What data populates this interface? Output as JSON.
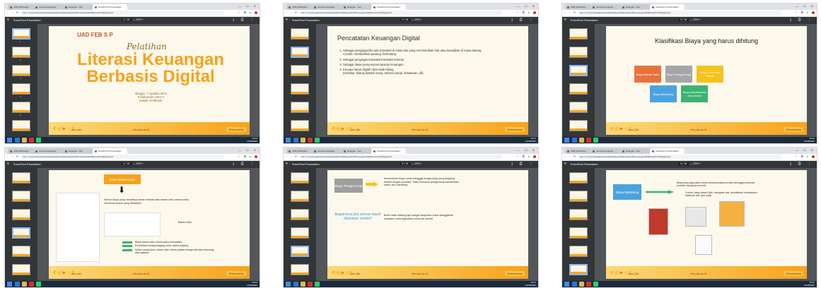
{
  "browser": {
    "tabs": [
      "(789) WhatsApp",
      "Literasi Keuangan...",
      "Ruangan - Kisi",
      "PowerPoint Presentation"
    ],
    "url": "File | C:/Users/Asus/Downloads/Pelatihan%20Literasi%20Keuangan%20Berbasis%20Digital.pdf",
    "window_controls": "— ☐ ✕"
  },
  "pdf_toolbar": {
    "title": "PowerPoint Presentation",
    "pages": [
      "1 / 16",
      "2 / 16",
      "3 / 16",
      "4 / 16",
      "5 / 16",
      "6 / 16"
    ],
    "zoom": "— 97% +",
    "right_icons": "⤓ ⎙ ⋮",
    "menu_icon": "≡"
  },
  "taskbar": {
    "clock": "15:01",
    "date": "14/08/2022"
  },
  "footer": {
    "icons": "✆ ◎ ▶ ♫ ƒ",
    "handle": "uad_feb",
    "web": "feb.uad.ac.id",
    "hashtag": "#feboadship"
  },
  "slide1": {
    "logos": "UAD  FEB S P",
    "script": "Pelatihan",
    "title_line1": "Literasi Keuangan",
    "title_line2": "Berbasis Digital",
    "date_line1": "Minggu, 7 Agustus 2022",
    "date_line2": "9 Muharram 1444 H",
    "date_line3": "Masjid Al-Hikmah"
  },
  "slide2": {
    "heading": "Pencatatan Keuangan Digital",
    "items": [
      {
        "text": "Sebagai pengingat bila ada transaksi di masa lalu yang menimbulkan hak atau kewajiban di masa datang.",
        "sub": "Contoh: memberikan piutang, berhutang"
      },
      {
        "text": "Sebagai pengingat transaksi-transaksi tertentu",
        "sub": ""
      },
      {
        "text": "Sebagai dasar penyusunan laporan keuangan",
        "sub": ""
      },
      {
        "text": "Kenapa harus digital? Biar tidak hilang",
        "sub": "(terbakar, hilang diambil orang, terkena banjir, kebakaran, dll)"
      }
    ]
  },
  "slide3": {
    "heading": "Klasifikasi Biaya yang harus dihitung",
    "boxes": [
      {
        "label": "Biaya Bahan Baku",
        "color": "#e9723b"
      },
      {
        "label": "Biaya Tenaga Kerja",
        "color": "#a6a6a6"
      },
      {
        "label": "Biaya Overhead Pabrik",
        "color": "#f6c21b"
      },
      {
        "label": "Biaya Marketing",
        "color": "#4aa3df"
      },
      {
        "label": "Biaya Administrasi dan Umum",
        "color": "#3cb371"
      }
    ]
  },
  "slide4": {
    "heading": "Biaya Bahan Baku",
    "desc": "Semua biaya yang mencakup bahan mentah atau bahan baku utama untuk membuat produk yang dihasilkan",
    "side_label": "Bahan baku",
    "bullets": [
      "Biaya bahan baku untuk usaha manufaktur",
      "Persediaan barang dagang untuk usaha dagang",
      "Dalam usaha jasa, bahan baku utama adalah tenaga ahli atau teknologi atau aplikasi"
    ]
  },
  "slide5": {
    "box": "Biaya Tenaga Kerja",
    "text1": "Keseluruhan biaya untuk menggaji tenaga kerja yang langsung terlibat dengan produksi. Tidak termasuk tenaga kerja administrasi, sales, dan marketing",
    "question": "Bagaimana jika semua masih dilakukan sendiri?",
    "text2": "Boleh tidak dihitung tapi sangat dianjurkan untuk dianggarkan meskipun nanti digunakan untuk diri sendiri"
  },
  "slide6": {
    "box": "Biaya Marketing",
    "text1": "Biaya yang digunakan untuk mempromosikan produk sehingga membuat pembeli menyukai membeli",
    "text2": "Contoh: biaya desain flyer, instagram ads, pendaftaran marketplace, facebook ads, give away"
  }
}
